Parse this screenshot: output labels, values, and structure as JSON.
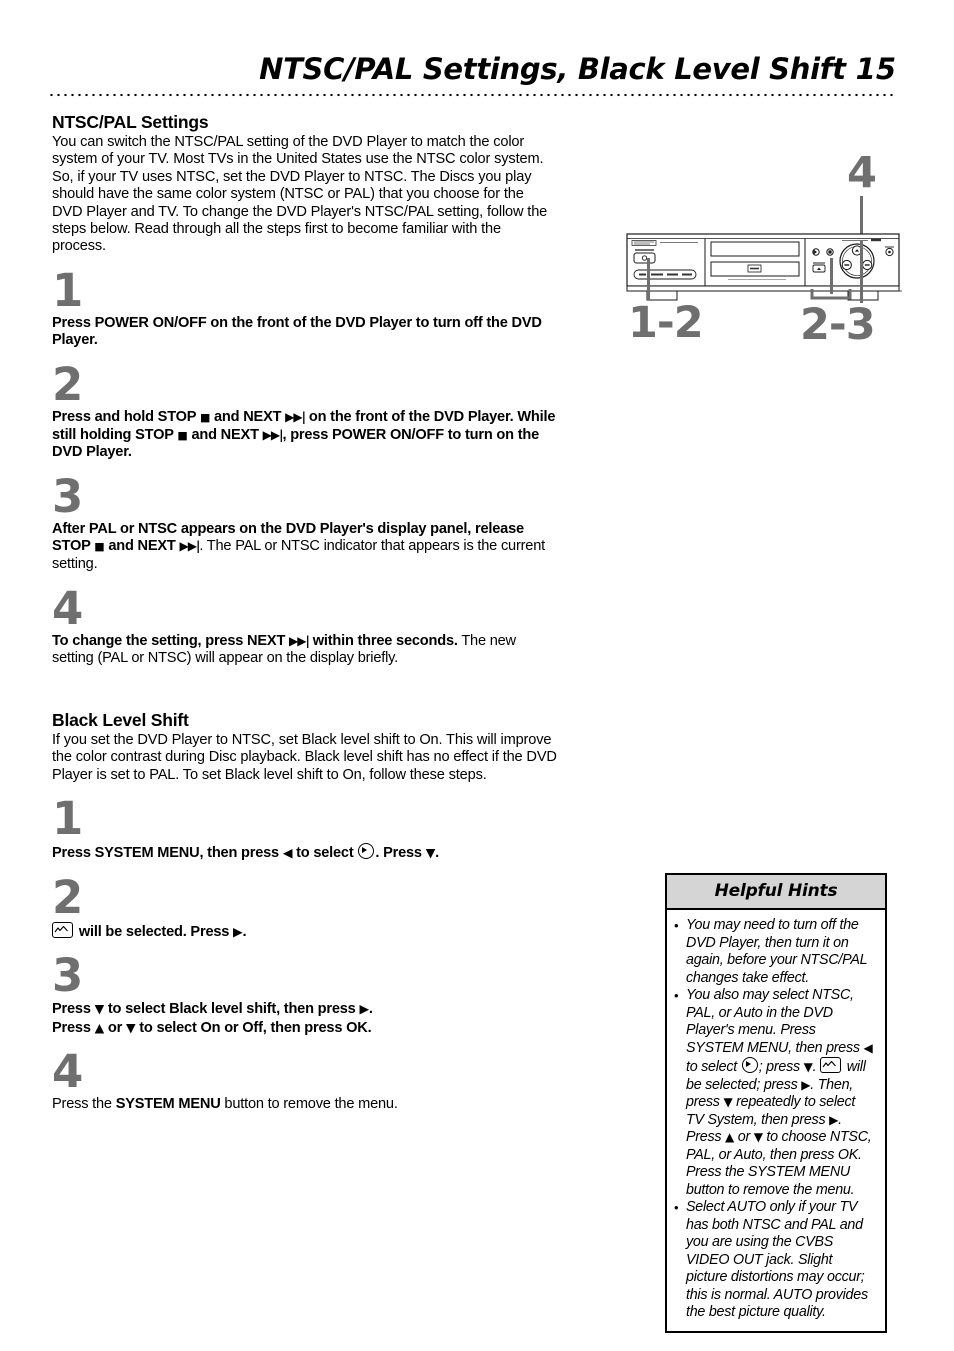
{
  "header": {
    "title": "NTSC/PAL Settings, Black Level Shift",
    "page_number": "15"
  },
  "sections": [
    {
      "title": "NTSC/PAL Settings",
      "intro": "You can switch the NTSC/PAL setting of the DVD Player to match the color system of your TV. Most TVs in the United States use the NTSC color system. So, if your TV uses NTSC, set the DVD Player to NTSC. The Discs you play should have the same color system (NTSC or PAL) that you choose for the DVD Player and TV. To change the DVD Player's NTSC/PAL setting, follow the steps below. Read through all the steps first to become familiar with the process.",
      "steps": [
        {
          "num": "1"
        },
        {
          "num": "2"
        },
        {
          "num": "3"
        },
        {
          "num": "4"
        }
      ]
    },
    {
      "title": "Black Level Shift",
      "intro": "If you set the DVD Player to NTSC, set Black level shift to On. This will improve the color contrast during Disc playback. Black level shift has no effect if the DVD Player is set to PAL. To set Black level shift to On, follow these steps.",
      "steps": [
        {
          "num": "1"
        },
        {
          "num": "2"
        },
        {
          "num": "3"
        },
        {
          "num": "4"
        }
      ]
    }
  ],
  "step_text": {
    "ntsc_1_bold_a": "Press POWER ON/OFF on the front of the DVD Player to turn off the DVD Player.",
    "ntsc_2_bold_a": "Press and hold STOP ",
    "ntsc_2_bold_b": " and NEXT ",
    "ntsc_2_bold_c": " on the front of the DVD Player. While still holding STOP ",
    "ntsc_2_bold_d": " and NEXT ",
    "ntsc_2_bold_e": ", press POWER ON/OFF to turn on the DVD Player.",
    "ntsc_3_bold_a": "After PAL or NTSC appears on the DVD Player's display panel, release STOP ",
    "ntsc_3_bold_b": " and NEXT ",
    "ntsc_3_plain": ". The PAL or NTSC indicator that appears is the current setting.",
    "ntsc_4_bold_a": "To change the setting, press NEXT ",
    "ntsc_4_bold_b": " within three seconds.",
    "ntsc_4_plain": " The new setting (PAL or NTSC) will appear on the display briefly.",
    "bls_1_a": "Press SYSTEM MENU, then press ",
    "bls_1_b": " to select ",
    "bls_1_c": ". Press ",
    "bls_1_d": ".",
    "bls_2_a": " will be selected. Press ",
    "bls_2_b": ".",
    "bls_3_line1_a": "Press ",
    "bls_3_line1_b": " to select Black level shift, then press ",
    "bls_3_line1_c": ".",
    "bls_3_line2_a": "Press ",
    "bls_3_line2_b": " or ",
    "bls_3_line2_c": " to select On or Off, then press OK.",
    "bls_4_a": "Press the ",
    "bls_4_b": "SYSTEM MENU",
    "bls_4_c": " button to remove the menu."
  },
  "symbols": {
    "stop": "■",
    "next": "▶▶|",
    "play_right": "▶",
    "left": "◀",
    "down": "▼",
    "up": "▲"
  },
  "diagram": {
    "device": "DVD Player front panel",
    "callouts": [
      {
        "name": "callout-4",
        "label": "4"
      },
      {
        "name": "callout-1-2",
        "label": "1-2"
      },
      {
        "name": "callout-2-3",
        "label": "2-3"
      }
    ]
  },
  "hints": {
    "title": "Helpful Hints",
    "items": [
      {
        "parts": [
          {
            "t": "text",
            "v": "You may need to turn off the DVD Player, then turn it on again, before your NTSC/PAL changes take effect."
          }
        ]
      },
      {
        "parts": [
          {
            "t": "text",
            "v": "You also may select NTSC, PAL, or Auto in the DVD Player's menu. Press SYSTEM MENU, then press "
          },
          {
            "t": "sym",
            "v": "◀"
          },
          {
            "t": "text",
            "v": " to select "
          },
          {
            "t": "icon",
            "v": "tv-circle-icon"
          },
          {
            "t": "text",
            "v": "; press "
          },
          {
            "t": "sym",
            "v": "▼"
          },
          {
            "t": "text",
            "v": ". "
          },
          {
            "t": "icon",
            "v": "picture-icon"
          },
          {
            "t": "text",
            "v": " will be selected; press "
          },
          {
            "t": "sym",
            "v": "▶"
          },
          {
            "t": "text",
            "v": ". Then, press "
          },
          {
            "t": "sym",
            "v": "▼"
          },
          {
            "t": "text",
            "v": " repeatedly to select TV System, then press "
          },
          {
            "t": "sym",
            "v": "▶"
          },
          {
            "t": "text",
            "v": ". Press "
          },
          {
            "t": "sym",
            "v": "▲"
          },
          {
            "t": "text",
            "v": " or "
          },
          {
            "t": "sym",
            "v": "▼"
          },
          {
            "t": "text",
            "v": " to choose NTSC, PAL, or Auto, then press OK. Press the SYSTEM MENU button to remove the menu."
          }
        ]
      },
      {
        "parts": [
          {
            "t": "text",
            "v": "Select AUTO only if your TV has both NTSC and PAL and you are using the CVBS VIDEO OUT jack. Slight picture distortions may occur; this is normal. AUTO provides the best picture quality."
          }
        ]
      }
    ],
    "bullet": "•"
  },
  "colors": {
    "step_number_gray": "#6f6f6f",
    "hints_header_gray": "#d5d5d5",
    "text_black": "#000000"
  }
}
